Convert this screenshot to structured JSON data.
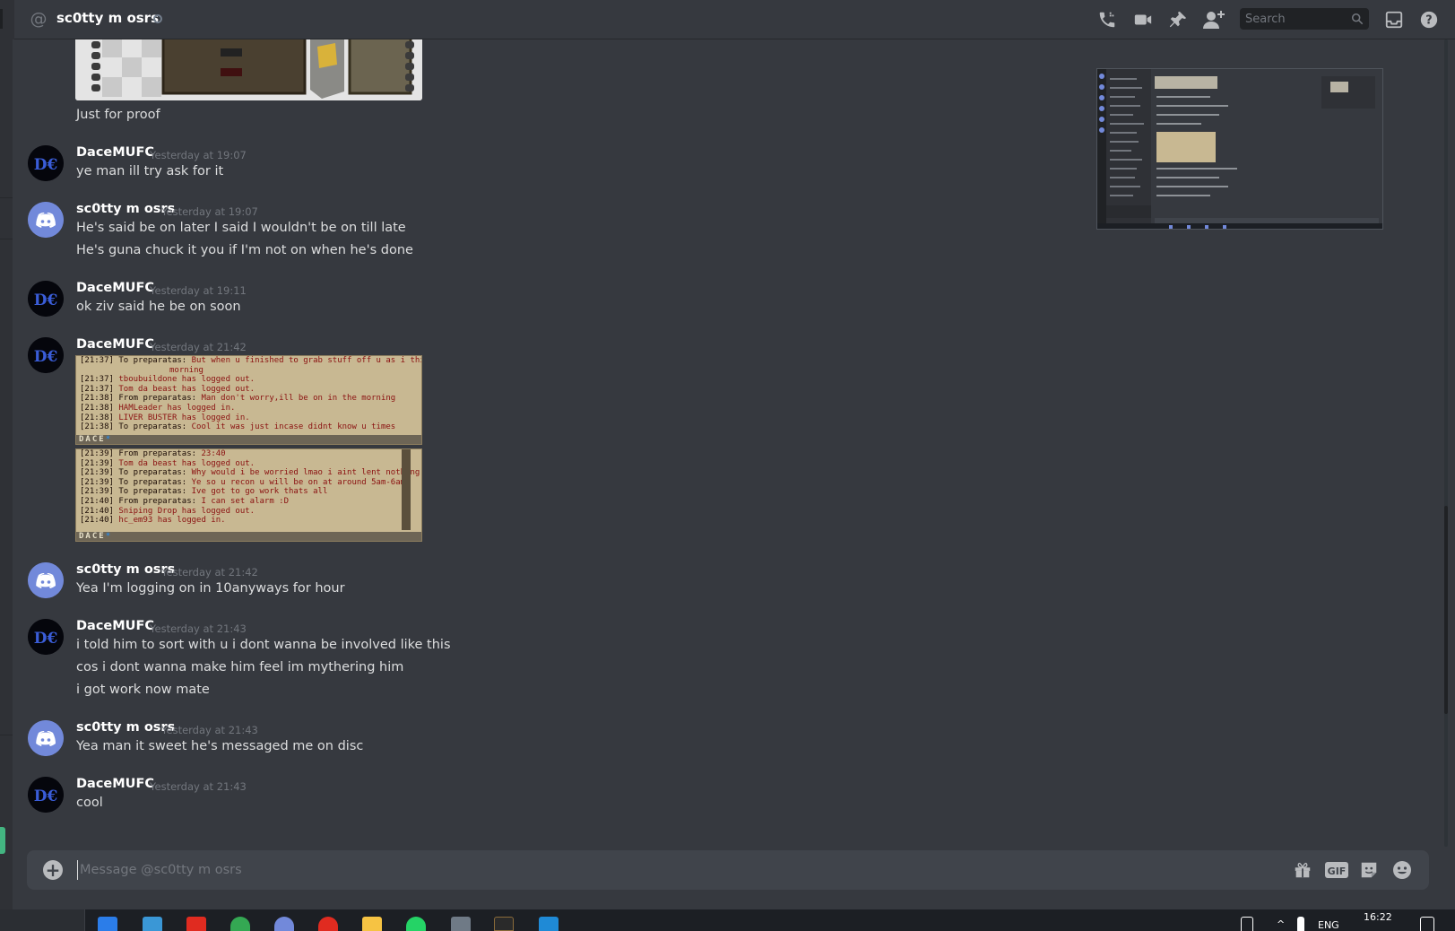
{
  "header": {
    "channel_name": "sc0tty m osrs",
    "search_placeholder": "Search"
  },
  "messages": [
    {
      "caption": "Just for proof"
    },
    {
      "author": "DaceMUFC",
      "timestamp": "Yesterday at 19:07",
      "lines": [
        "ye man ill try ask for it"
      ]
    },
    {
      "author": "sc0tty m osrs",
      "timestamp": "Yesterday at 19:07",
      "lines": [
        "He's said be on later I said I wouldn't be on till late",
        "He's guna chuck it you if I'm not on when he's done"
      ]
    },
    {
      "author": "DaceMUFC",
      "timestamp": "Yesterday at 19:11",
      "lines": [
        "ok ziv said he be on soon"
      ]
    },
    {
      "author": "DaceMUFC",
      "timestamp": "Yesterday at 21:42",
      "chatlog1": [
        {
          "time": "[21:37]",
          "who": "To preparatas:",
          "text": "But when u finished to grab stuff off u as i think he needs in"
        },
        {
          "time": "",
          "who": "",
          "text": "morning"
        },
        {
          "time": "[21:37]",
          "who": "tboubuildone has logged out.",
          "text": ""
        },
        {
          "time": "[21:37]",
          "who": "Tom da beast has logged out.",
          "text": ""
        },
        {
          "time": "[21:38]",
          "who": "From preparatas:",
          "text": "Man don't worry,ill be on in the morning"
        },
        {
          "time": "[21:38]",
          "who": "HAMLeader has logged in.",
          "text": ""
        },
        {
          "time": "[21:38]",
          "who": "LIVER BUSTER has logged in.",
          "text": ""
        },
        {
          "time": "[21:38]",
          "who": "To preparatas:",
          "text": "Cool it was just incase didnt know u times"
        }
      ],
      "chatlog2": [
        {
          "time": "[21:39]",
          "who": "From preparatas:",
          "text": "23:40"
        },
        {
          "time": "[21:39]",
          "who": "Tom da beast has logged out.",
          "text": ""
        },
        {
          "time": "[21:39]",
          "who": "To preparatas:",
          "text": "Why would i be worried lmao i aint lent nothing"
        },
        {
          "time": "[21:39]",
          "who": "To preparatas:",
          "text": "Ye so u recon u will be on at around 5am-6am?"
        },
        {
          "time": "[21:39]",
          "who": "To preparatas:",
          "text": "Ive got to go work thats all"
        },
        {
          "time": "[21:40]",
          "who": "From preparatas:",
          "text": "I can set alarm :D"
        },
        {
          "time": "[21:40]",
          "who": "Sniping Drop has logged out.",
          "text": ""
        },
        {
          "time": "[21:40]",
          "who": "hc_em93 has logged in.",
          "text": ""
        }
      ],
      "chat_input_name": "DACE"
    },
    {
      "author": "sc0tty m osrs",
      "timestamp": "Yesterday at 21:42",
      "lines": [
        "Yea I'm logging on in 10anyways for hour"
      ]
    },
    {
      "author": "DaceMUFC",
      "timestamp": "Yesterday at 21:43",
      "lines": [
        "i told him to sort with u i dont wanna be involved like this",
        "cos i dont wanna make him feel im mythering him",
        "i got work now mate"
      ]
    },
    {
      "author": "sc0tty m osrs",
      "timestamp": "Yesterday at 21:43",
      "lines": [
        "Yea man it sweet he's messaged me on disc"
      ]
    },
    {
      "author": "DaceMUFC",
      "timestamp": "Yesterday at 21:43",
      "lines": [
        "cool"
      ]
    }
  ],
  "composer": {
    "placeholder": "Message @sc0tty m osrs",
    "gif_label": "GIF"
  },
  "taskbar": {
    "language": "ENG",
    "time": "16:22"
  },
  "colors": {
    "background": "#36393f",
    "blurple": "#7289da",
    "online_green": "#43b581"
  }
}
